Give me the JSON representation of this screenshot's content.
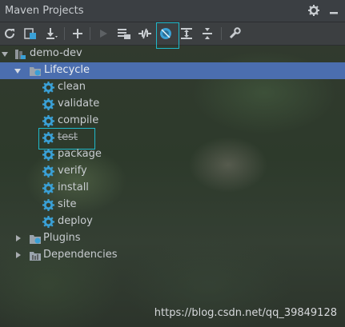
{
  "window": {
    "title": "Maven Projects"
  },
  "titlebar_icons": [
    "gear-icon",
    "minimize-icon"
  ],
  "toolbar": {
    "buttons": [
      "reimport-icon",
      "generate-sources-icon",
      "download-icon",
      "add-icon",
      "run-icon",
      "execute-goal-icon",
      "toggle-offline-icon",
      "skip-tests-icon",
      "show-dependencies-icon",
      "collapse-all-icon",
      "settings-wrench-icon"
    ],
    "active_button": "skip-tests-icon"
  },
  "tree": {
    "project": "demo-dev",
    "lifecycle_label": "Lifecycle",
    "goals": [
      "clean",
      "validate",
      "compile",
      "test",
      "package",
      "verify",
      "install",
      "site",
      "deploy"
    ],
    "skipped_goal": "test",
    "plugins_label": "Plugins",
    "dependencies_label": "Dependencies"
  },
  "watermark": "https://blog.csdn.net/qq_39849128",
  "colors": {
    "selection": "#4b6eaf",
    "highlight_box": "#1fb8c9",
    "gear": "#3aa0d6"
  }
}
